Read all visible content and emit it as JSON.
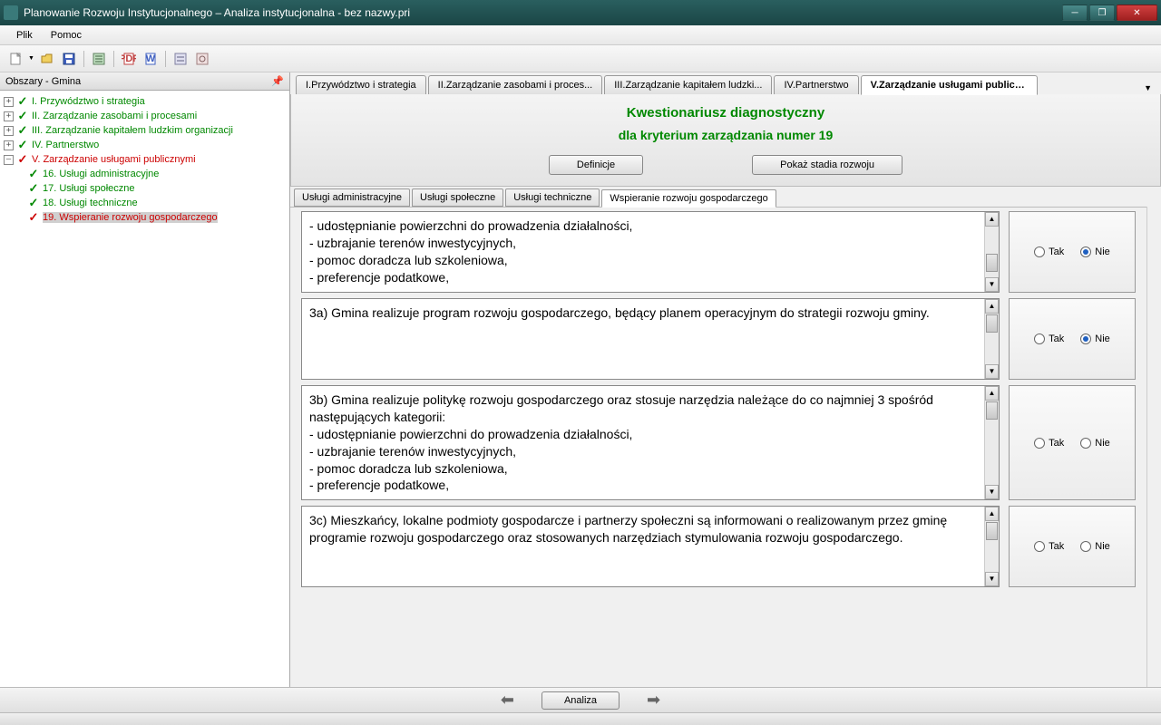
{
  "window": {
    "title": "Planowanie Rozwoju Instytucjonalnego – Analiza instytucjonalna - bez nazwy.pri"
  },
  "menu": {
    "file": "Plik",
    "help": "Pomoc"
  },
  "sidebar": {
    "header": "Obszary - Gmina",
    "items": [
      {
        "label": "I. Przywództwo i strategia",
        "color": "green",
        "check": "green",
        "expand": "+"
      },
      {
        "label": "II. Zarządzanie zasobami i procesami",
        "color": "green",
        "check": "green",
        "expand": "+"
      },
      {
        "label": "III. Zarządzanie kapitałem ludzkim organizacji",
        "color": "green",
        "check": "green",
        "expand": "+"
      },
      {
        "label": "IV. Partnerstwo",
        "color": "green",
        "check": "green",
        "expand": "+"
      },
      {
        "label": "V. Zarządzanie usługami publicznymi",
        "color": "red",
        "check": "red",
        "expand": "–"
      }
    ],
    "children": [
      {
        "label": "16. Usługi administracyjne",
        "color": "green",
        "check": "green"
      },
      {
        "label": "17. Usługi społeczne",
        "color": "green",
        "check": "green"
      },
      {
        "label": "18. Usługi techniczne",
        "color": "green",
        "check": "green"
      },
      {
        "label": "19. Wspieranie rozwoju gospodarczego",
        "color": "red",
        "check": "red",
        "selected": true
      }
    ]
  },
  "topTabs": [
    "I.Przywództwo i strategia",
    "II.Zarządzanie zasobami i proces...",
    "III.Zarządzanie kapitałem ludzki...",
    "IV.Partnerstwo",
    "V.Zarządzanie usługami publicz..."
  ],
  "header": {
    "title": "Kwestionariusz diagnostyczny",
    "subtitle": "dla kryterium zarządzania numer 19",
    "btn1": "Definicje",
    "btn2": "Pokaż stadia rozwoju"
  },
  "subTabs": [
    "Usługi administracyjne",
    "Usługi społeczne",
    "Usługi techniczne",
    "Wspieranie rozwoju gospodarczego"
  ],
  "answers": {
    "yes": "Tak",
    "no": "Nie"
  },
  "questions": [
    {
      "text": "- udostępnianie powierzchni do prowadzenia działalności,\n- uzbrajanie terenów inwestycyjnych,\n- pomoc doradcza lub szkoleniowa,\n- preferencje podatkowe,",
      "sel": "no",
      "partial": true
    },
    {
      "text": "3a) Gmina realizuje program rozwoju gospodarczego, będący planem operacyjnym do strategii rozwoju gminy.",
      "sel": "no"
    },
    {
      "text": "3b) Gmina realizuje politykę rozwoju gospodarczego oraz stosuje narzędzia należące do co najmniej 3 spośród następujących kategorii:\n- udostępnianie powierzchni do prowadzenia działalności,\n- uzbrajanie terenów inwestycyjnych,\n- pomoc doradcza lub szkoleniowa,\n- preferencje podatkowe,",
      "sel": ""
    },
    {
      "text": "3c) Mieszkańcy, lokalne podmioty gospodarcze i partnerzy społeczni są informowani o realizowanym przez gminę programie rozwoju gospodarczego oraz stosowanych narzędziach stymulowania rozwoju gospodarczego.",
      "sel": ""
    }
  ],
  "footer": {
    "analyze": "Analiza"
  }
}
